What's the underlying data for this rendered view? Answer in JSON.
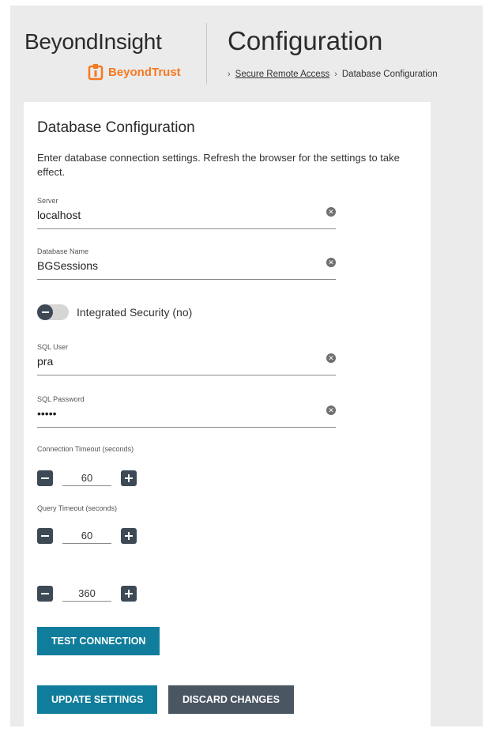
{
  "header": {
    "brand_title": "BeyondInsight",
    "brand_sub": "BeyondTrust",
    "page_title": "Configuration",
    "breadcrumb": {
      "sep": "›",
      "link": "Secure Remote Access",
      "current": "Database Configuration"
    }
  },
  "card": {
    "title": "Database Configuration",
    "description": "Enter database connection settings. Refresh the browser for the settings to take effect."
  },
  "fields": {
    "server": {
      "label": "Server",
      "value": "localhost"
    },
    "database_name": {
      "label": "Database Name",
      "value": "BGSessions"
    },
    "sql_user": {
      "label": "SQL User",
      "value": "pra"
    },
    "sql_password": {
      "label": "SQL Password",
      "value": "•••••"
    }
  },
  "toggle": {
    "label": "Integrated Security (no)",
    "checked": false
  },
  "steppers": {
    "connection_timeout": {
      "label": "Connection Timeout (seconds)",
      "value": "60"
    },
    "query_timeout": {
      "label": "Query Timeout (seconds)",
      "value": "60"
    },
    "third": {
      "label": "",
      "value": "360"
    }
  },
  "buttons": {
    "test_connection": "TEST CONNECTION",
    "update_settings": "UPDATE SETTINGS",
    "discard_changes": "DISCARD CHANGES"
  },
  "icons": {
    "clear": "clear-icon",
    "minus": "minus-icon",
    "plus": "plus-icon",
    "logo": "beyondtrust-logo-icon"
  },
  "colors": {
    "brand_orange": "#f47920",
    "primary_button": "#0f7d9b",
    "secondary_button": "#4a5661",
    "dark_control": "#3d4a55"
  }
}
